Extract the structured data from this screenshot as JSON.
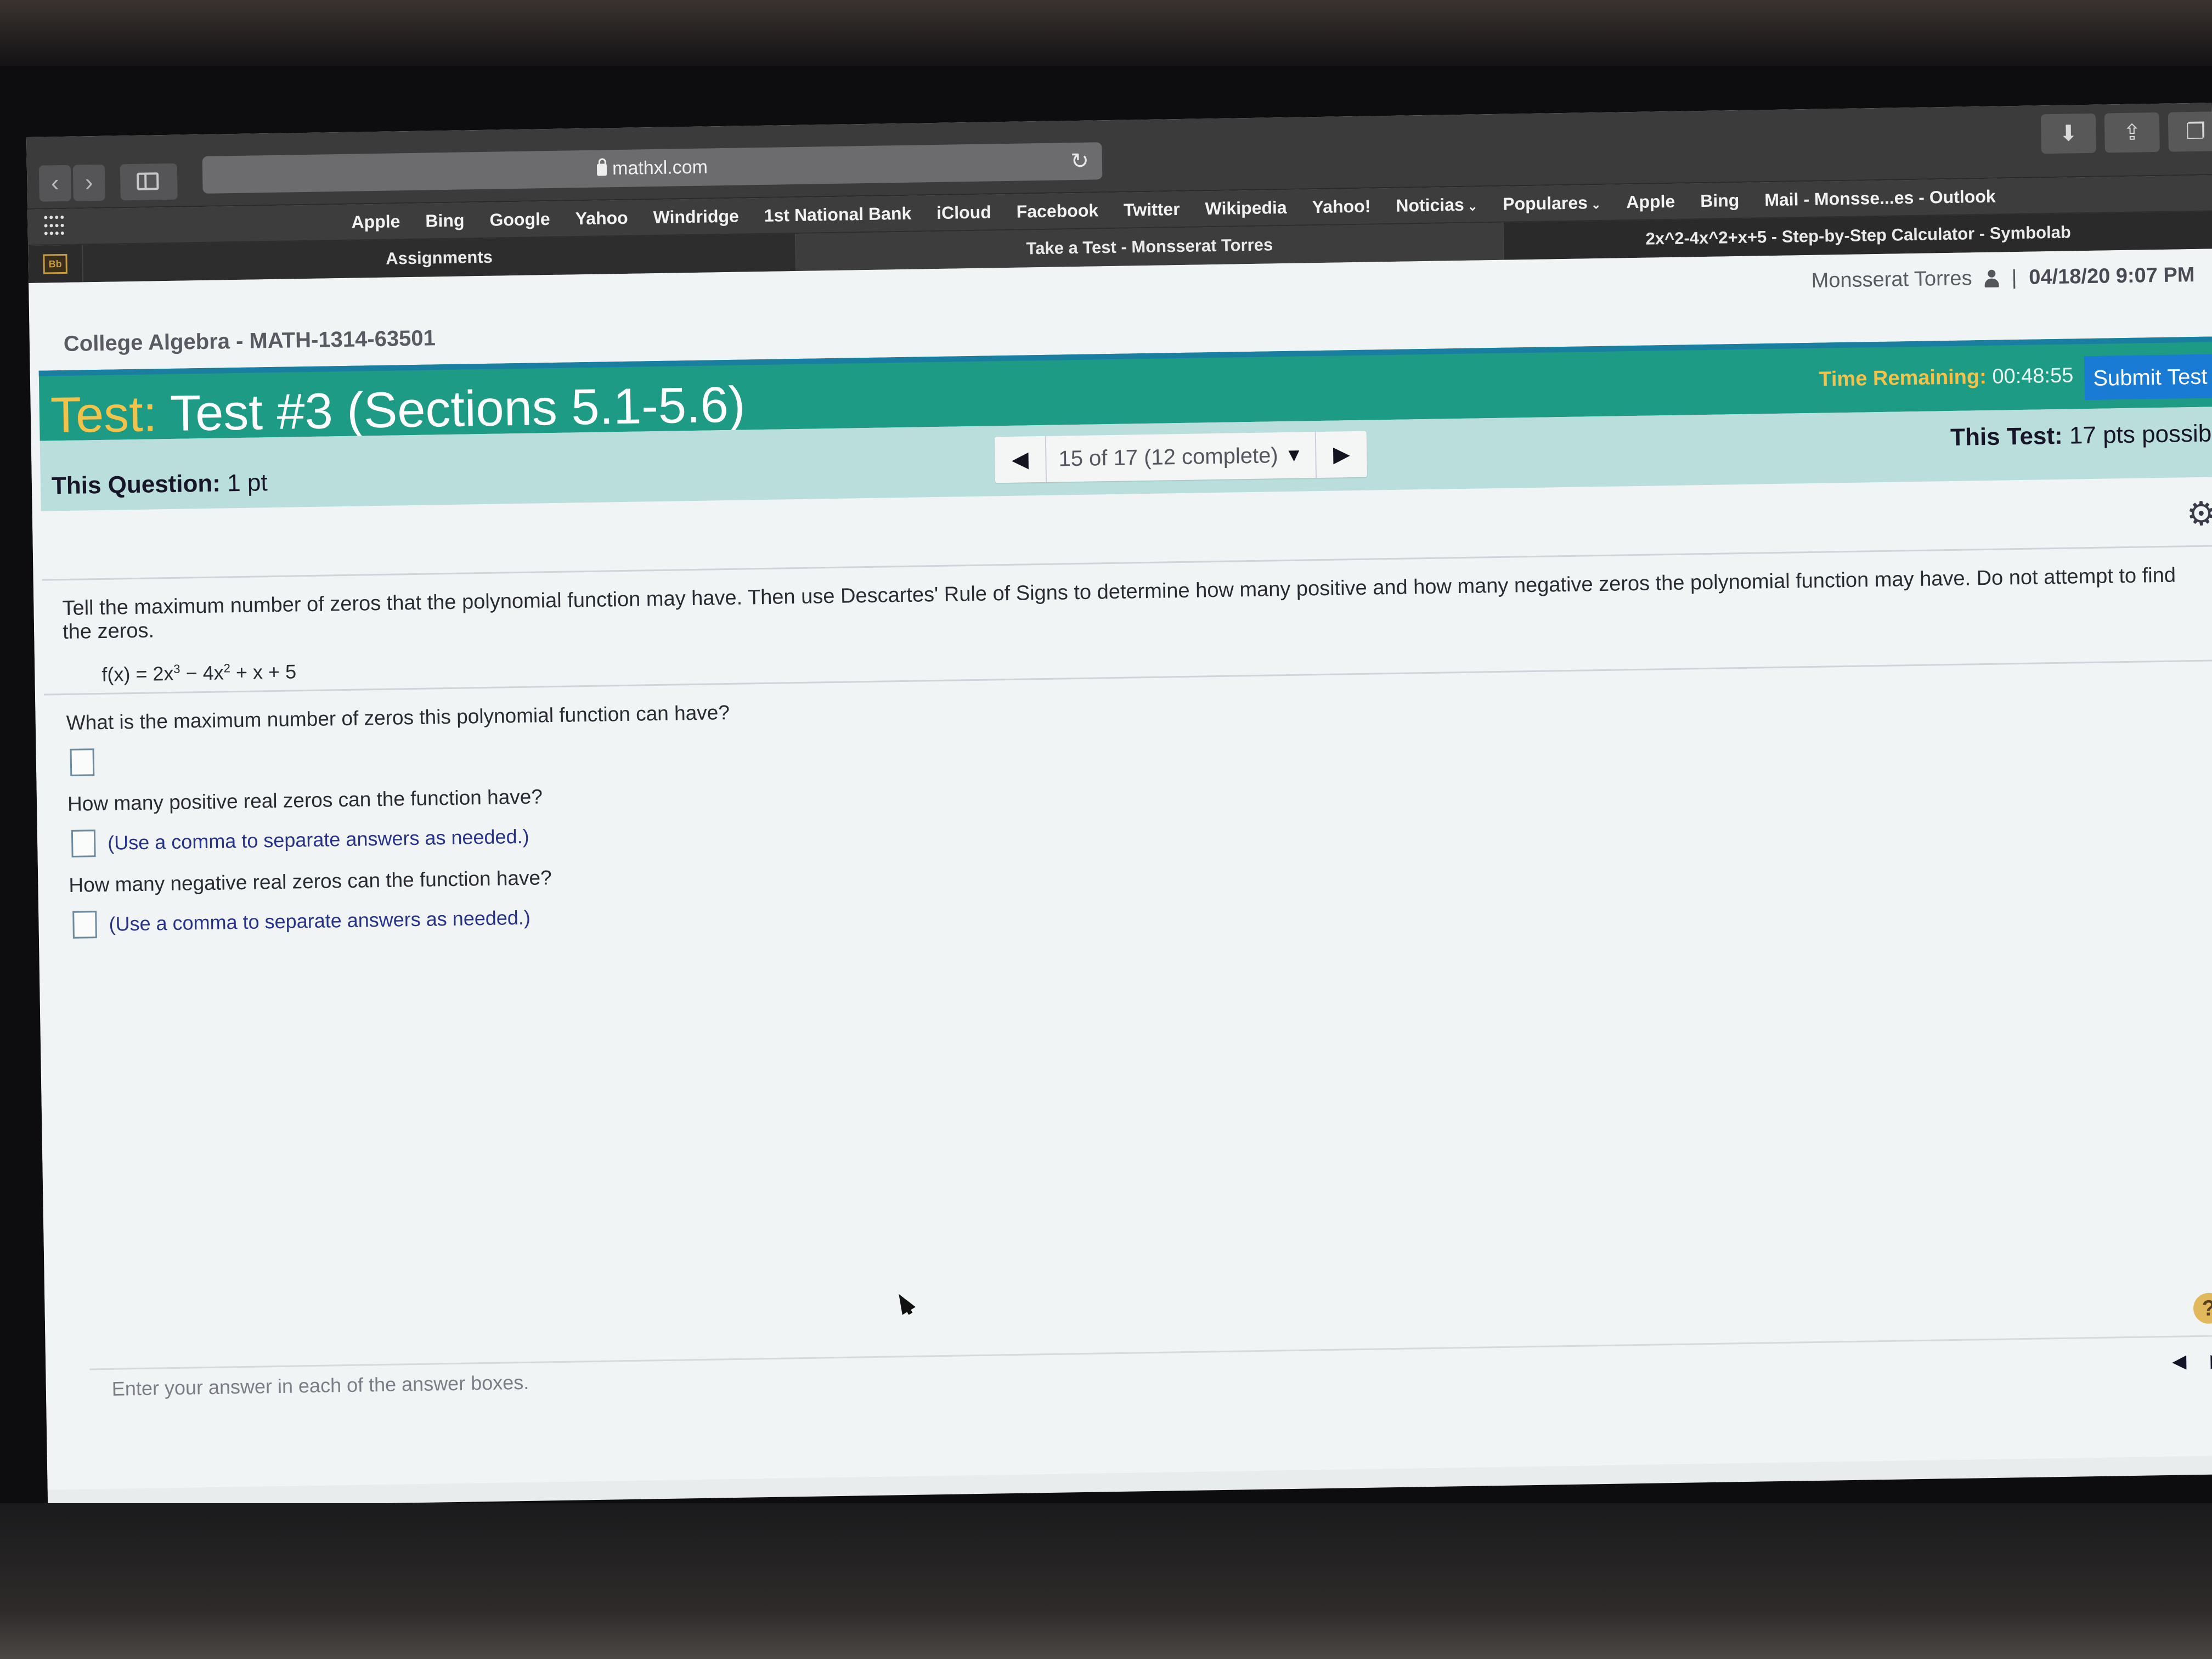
{
  "browser": {
    "url": "mathxl.com",
    "icons": {
      "back": "chevron-left-icon",
      "forward": "chevron-right-icon",
      "sidebar": "sidebar-icon",
      "lock": "lock-icon",
      "reload": "reload-icon",
      "download": "download-icon",
      "share": "share-icon",
      "tabs": "tabs-icon",
      "apps": "apps-grid-icon"
    },
    "bookmarks": [
      {
        "label": "Apple"
      },
      {
        "label": "Bing"
      },
      {
        "label": "Google"
      },
      {
        "label": "Yahoo"
      },
      {
        "label": "Windridge"
      },
      {
        "label": "1st National Bank"
      },
      {
        "label": "iCloud"
      },
      {
        "label": "Facebook"
      },
      {
        "label": "Twitter"
      },
      {
        "label": "Wikipedia"
      },
      {
        "label": "Yahoo!"
      },
      {
        "label": "Noticias",
        "dropdown": true
      },
      {
        "label": "Populares",
        "dropdown": true
      },
      {
        "label": "Apple"
      },
      {
        "label": "Bing"
      },
      {
        "label": "Mail - Monsse...es - Outlook"
      }
    ],
    "tabs": [
      {
        "label": "Bb",
        "pinned": true
      },
      {
        "label": "Assignments"
      },
      {
        "label": "Take a Test - Monsserat Torres",
        "active": true
      },
      {
        "label": "2x^2-4x^2+x+5 - Step-by-Step Calculator - Symbolab"
      }
    ],
    "dropdown_glyph": "⌄"
  },
  "header": {
    "user_name": "Monsserat Torres",
    "separator": "|",
    "datetime": "04/18/20 9:07 PM",
    "course": "College Algebra - MATH-1314-63501"
  },
  "test_bar": {
    "label": "Test:",
    "title": "Test #3 (Sections 5.1-5.6)",
    "time_label": "Time Remaining:",
    "time_value": "00:48:55",
    "submit_label": "Submit Test",
    "colors": {
      "bar": "#1e9b84",
      "accent": "#f2c24a",
      "submit": "#1a7bd4"
    }
  },
  "question_bar": {
    "question_label": "This Question:",
    "question_points": "1 pt",
    "test_label": "This Test:",
    "test_points": "17 pts possibl",
    "nav_prev": "◀",
    "nav_next": "▶",
    "nav_status": "15 of 17 (12 complete)",
    "nav_caret": "▼"
  },
  "question": {
    "instructions": "Tell the maximum number of zeros that the polynomial function may have.  Then use Descartes' Rule of Signs to determine how many positive and how many negative zeros the polynomial function may have.  Do not attempt to find the zeros.",
    "formula_prefix": "f(x) = 2x",
    "formula_exp1": "3",
    "formula_mid": " − 4x",
    "formula_exp2": "2",
    "formula_suffix": " + x + 5",
    "parts": [
      {
        "prompt": "What is the maximum number of zeros this polynomial function can have?",
        "value": "",
        "hint": ""
      },
      {
        "prompt": "How many positive real zeros can the function have?",
        "value": "",
        "hint": "(Use a comma to separate answers as needed.)"
      },
      {
        "prompt": "How many negative real zeros can the function have?",
        "value": "",
        "hint": "(Use a comma to separate answers as needed.)"
      }
    ]
  },
  "footer": {
    "instruction": "Enter your answer in each of the answer boxes.",
    "help": "?",
    "prev": "◀",
    "next": "▶"
  },
  "icons": {
    "settings": "⚙"
  }
}
